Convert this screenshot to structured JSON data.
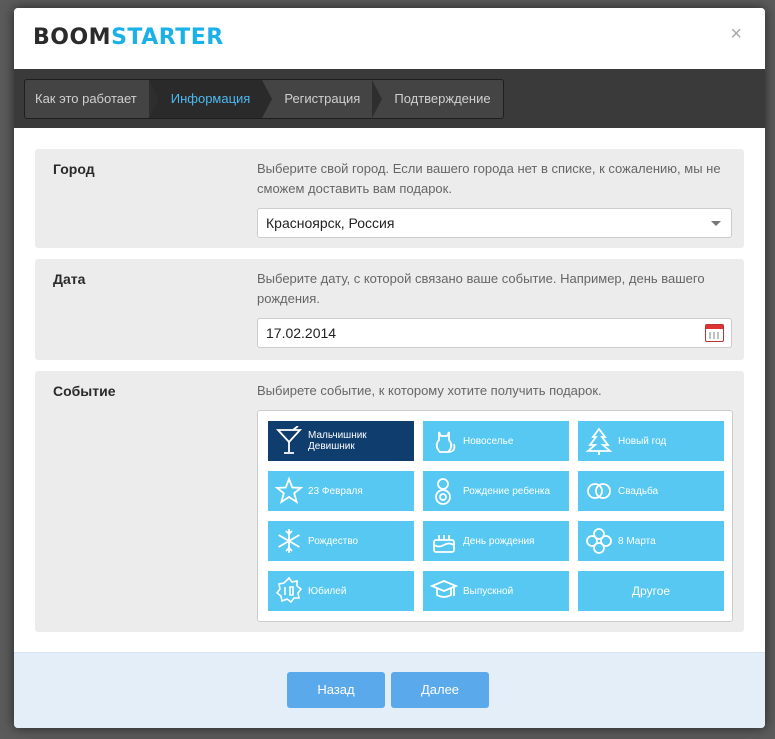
{
  "brand": {
    "part1": "BOOM",
    "part2": "STARTER"
  },
  "close_symbol": "×",
  "steps": [
    {
      "label": "Как это работает",
      "active": false
    },
    {
      "label": "Информация",
      "active": true
    },
    {
      "label": "Регистрация",
      "active": false
    },
    {
      "label": "Подтверждение",
      "active": false
    }
  ],
  "city": {
    "label": "Город",
    "hint": "Выберите свой город. Если вашего города нет в списке, к сожалению, мы не сможем доставить вам подарок.",
    "value": "Красноярск, Россия"
  },
  "date": {
    "label": "Дата",
    "hint": "Выберите дату, с которой связано ваше событие. Например, день вашего рождения.",
    "value": "17.02.2014"
  },
  "event": {
    "label": "Событие",
    "hint": "Выбирете событие, к которому хотите получить подарок.",
    "options": [
      {
        "label": "Мальчишник\nДевишник",
        "icon": "cocktail-icon",
        "active": true
      },
      {
        "label": "Новоселье",
        "icon": "cat-icon",
        "active": false
      },
      {
        "label": "Новый год",
        "icon": "christmas-tree-icon",
        "active": false
      },
      {
        "label": "23 Февраля",
        "icon": "star-icon",
        "active": false
      },
      {
        "label": "Рождение ребенка",
        "icon": "baby-icon",
        "active": false
      },
      {
        "label": "Свадьба",
        "icon": "rings-icon",
        "active": false
      },
      {
        "label": "Рождество",
        "icon": "snowflake-icon",
        "active": false
      },
      {
        "label": "День рождения",
        "icon": "birthday-cake-icon",
        "active": false
      },
      {
        "label": "8 Марта",
        "icon": "flower-icon",
        "active": false
      },
      {
        "label": "Юбилей",
        "icon": "anniversary-10-icon",
        "active": false
      },
      {
        "label": "Выпускной",
        "icon": "graduation-cap-icon",
        "active": false
      },
      {
        "label": "Другое",
        "icon": "",
        "active": false
      }
    ]
  },
  "buttons": {
    "back": "Назад",
    "next": "Далее"
  },
  "colors": {
    "accent": "#56c8f2",
    "active_event": "#0f3d6e",
    "button": "#5aa9ea",
    "active_step_text": "#4db8f0"
  }
}
